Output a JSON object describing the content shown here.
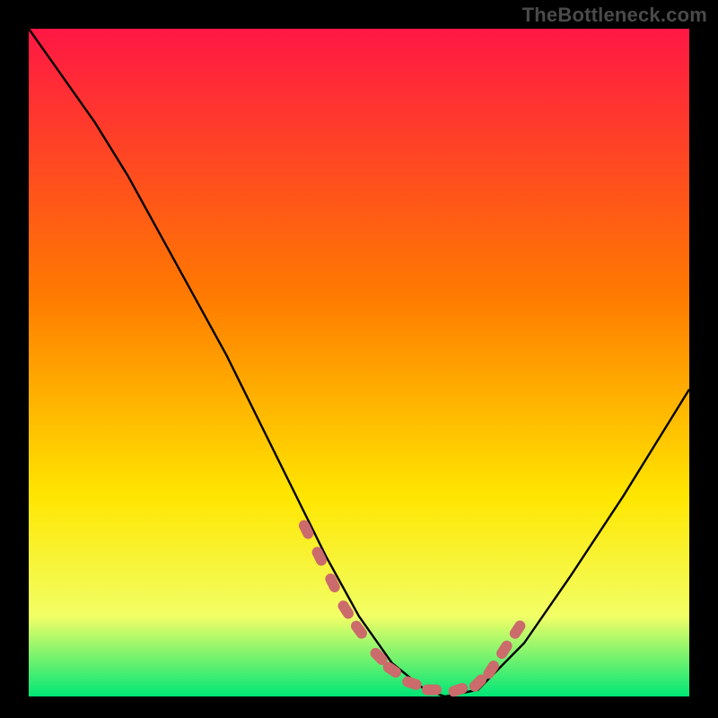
{
  "watermark": "TheBottleneck.com",
  "chart_data": {
    "type": "line",
    "title": "",
    "xlabel": "",
    "ylabel": "",
    "xlim": [
      0,
      100
    ],
    "ylim": [
      0,
      100
    ],
    "grid": false,
    "series": [
      {
        "name": "bottleneck-curve",
        "x": [
          0,
          5,
          10,
          15,
          20,
          25,
          30,
          35,
          40,
          45,
          50,
          55,
          60,
          63,
          68,
          75,
          82,
          90,
          100
        ],
        "y": [
          100,
          93,
          86,
          78,
          69,
          60,
          51,
          41,
          31,
          21,
          12,
          5,
          1,
          0,
          1,
          8,
          18,
          30,
          46
        ]
      }
    ],
    "markers": {
      "name": "highlight-dots",
      "x": [
        42,
        44,
        46,
        48,
        50,
        53,
        55,
        58,
        61,
        65,
        68,
        70,
        72,
        74
      ],
      "y": [
        25,
        21,
        17,
        13,
        10,
        6,
        4,
        2,
        1,
        1,
        2,
        4,
        7,
        10
      ]
    },
    "background_gradient": {
      "top": "#ff1744",
      "mid1": "#ff7a00",
      "mid2": "#ffe600",
      "mid3": "#f2ff66",
      "bottom": "#00e676"
    },
    "curve_color": "#000000",
    "marker_color": "#cc6b6b"
  }
}
